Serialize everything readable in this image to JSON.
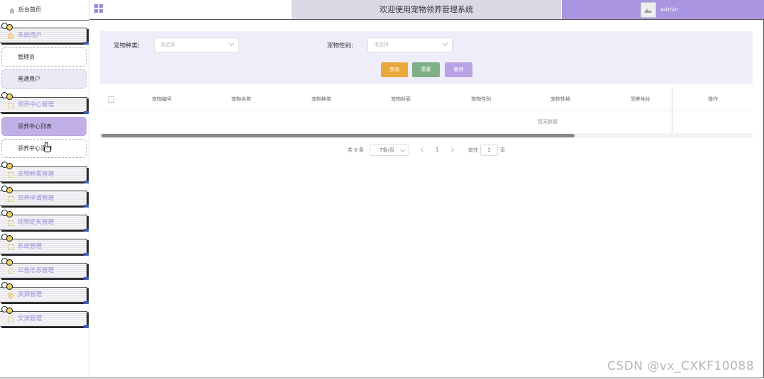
{
  "header": {
    "welcome": "欢迎使用宠物领养管理系统",
    "username": "admin"
  },
  "sidebar": {
    "home": "后台首页",
    "menus": [
      {
        "label": "系统用户",
        "icon": "user-icon"
      },
      {
        "label": "领养中心管理",
        "icon": "folder-icon"
      },
      {
        "label": "宠物种类管理",
        "icon": "folder-icon"
      },
      {
        "label": "领养申请管理",
        "icon": "folder-icon"
      },
      {
        "label": "动物走失管理",
        "icon": "folder-icon"
      },
      {
        "label": "系统管理",
        "icon": "folder-icon"
      },
      {
        "label": "公告信息管理",
        "icon": "info-icon"
      },
      {
        "label": "资源管理",
        "icon": "location-icon"
      },
      {
        "label": "交流管理",
        "icon": "folder-icon"
      }
    ],
    "sub_system_users": [
      "管理员",
      "普通用户"
    ],
    "sub_adoption_center": [
      "领养中心列表",
      "领养中心添加"
    ]
  },
  "filter": {
    "pet_type_label": "宠物种类:",
    "pet_type_placeholder": "请选择",
    "pet_gender_label": "宠物性别:",
    "pet_gender_placeholder": "请选择",
    "query_button": "查询",
    "reset_button": "重置",
    "delete_button": "删除"
  },
  "table": {
    "columns": [
      "宠物编号",
      "宠物名称",
      "宠物种类",
      "宠物封面",
      "宠物性别",
      "宠物性格",
      "领养地址",
      "操作"
    ],
    "empty_text": "暂无数据"
  },
  "pagination": {
    "total": "共 0 条",
    "page_size": "7条/页",
    "current_page": "1",
    "goto_label": "前往",
    "goto_value": "1",
    "page_suffix": "页"
  },
  "watermark": "CSDN @vx_CXKF10088",
  "colors": {
    "accent": "#a995e0",
    "query": "#e8a93a",
    "reset": "#7faf86",
    "delete": "#b9a2e6"
  }
}
